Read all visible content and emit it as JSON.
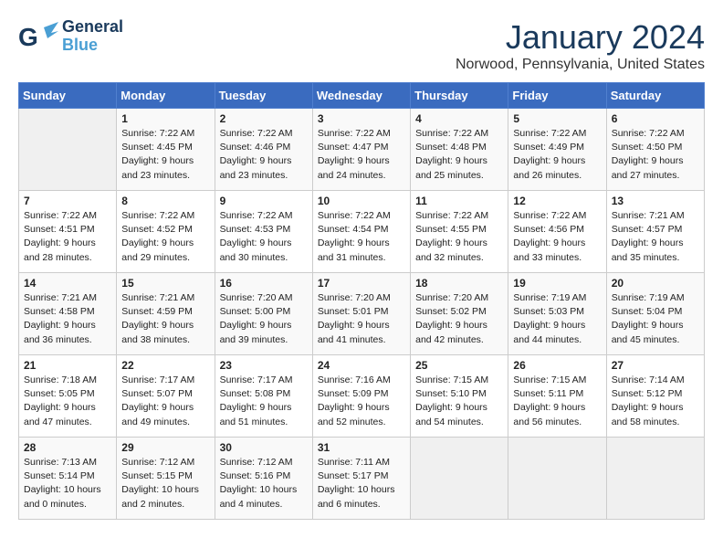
{
  "header": {
    "logo_general": "General",
    "logo_blue": "Blue",
    "month": "January 2024",
    "location": "Norwood, Pennsylvania, United States"
  },
  "weekdays": [
    "Sunday",
    "Monday",
    "Tuesday",
    "Wednesday",
    "Thursday",
    "Friday",
    "Saturday"
  ],
  "weeks": [
    [
      {
        "day": "",
        "info": ""
      },
      {
        "day": "1",
        "info": "Sunrise: 7:22 AM\nSunset: 4:45 PM\nDaylight: 9 hours\nand 23 minutes."
      },
      {
        "day": "2",
        "info": "Sunrise: 7:22 AM\nSunset: 4:46 PM\nDaylight: 9 hours\nand 23 minutes."
      },
      {
        "day": "3",
        "info": "Sunrise: 7:22 AM\nSunset: 4:47 PM\nDaylight: 9 hours\nand 24 minutes."
      },
      {
        "day": "4",
        "info": "Sunrise: 7:22 AM\nSunset: 4:48 PM\nDaylight: 9 hours\nand 25 minutes."
      },
      {
        "day": "5",
        "info": "Sunrise: 7:22 AM\nSunset: 4:49 PM\nDaylight: 9 hours\nand 26 minutes."
      },
      {
        "day": "6",
        "info": "Sunrise: 7:22 AM\nSunset: 4:50 PM\nDaylight: 9 hours\nand 27 minutes."
      }
    ],
    [
      {
        "day": "7",
        "info": "Sunrise: 7:22 AM\nSunset: 4:51 PM\nDaylight: 9 hours\nand 28 minutes."
      },
      {
        "day": "8",
        "info": "Sunrise: 7:22 AM\nSunset: 4:52 PM\nDaylight: 9 hours\nand 29 minutes."
      },
      {
        "day": "9",
        "info": "Sunrise: 7:22 AM\nSunset: 4:53 PM\nDaylight: 9 hours\nand 30 minutes."
      },
      {
        "day": "10",
        "info": "Sunrise: 7:22 AM\nSunset: 4:54 PM\nDaylight: 9 hours\nand 31 minutes."
      },
      {
        "day": "11",
        "info": "Sunrise: 7:22 AM\nSunset: 4:55 PM\nDaylight: 9 hours\nand 32 minutes."
      },
      {
        "day": "12",
        "info": "Sunrise: 7:22 AM\nSunset: 4:56 PM\nDaylight: 9 hours\nand 33 minutes."
      },
      {
        "day": "13",
        "info": "Sunrise: 7:21 AM\nSunset: 4:57 PM\nDaylight: 9 hours\nand 35 minutes."
      }
    ],
    [
      {
        "day": "14",
        "info": "Sunrise: 7:21 AM\nSunset: 4:58 PM\nDaylight: 9 hours\nand 36 minutes."
      },
      {
        "day": "15",
        "info": "Sunrise: 7:21 AM\nSunset: 4:59 PM\nDaylight: 9 hours\nand 38 minutes."
      },
      {
        "day": "16",
        "info": "Sunrise: 7:20 AM\nSunset: 5:00 PM\nDaylight: 9 hours\nand 39 minutes."
      },
      {
        "day": "17",
        "info": "Sunrise: 7:20 AM\nSunset: 5:01 PM\nDaylight: 9 hours\nand 41 minutes."
      },
      {
        "day": "18",
        "info": "Sunrise: 7:20 AM\nSunset: 5:02 PM\nDaylight: 9 hours\nand 42 minutes."
      },
      {
        "day": "19",
        "info": "Sunrise: 7:19 AM\nSunset: 5:03 PM\nDaylight: 9 hours\nand 44 minutes."
      },
      {
        "day": "20",
        "info": "Sunrise: 7:19 AM\nSunset: 5:04 PM\nDaylight: 9 hours\nand 45 minutes."
      }
    ],
    [
      {
        "day": "21",
        "info": "Sunrise: 7:18 AM\nSunset: 5:05 PM\nDaylight: 9 hours\nand 47 minutes."
      },
      {
        "day": "22",
        "info": "Sunrise: 7:17 AM\nSunset: 5:07 PM\nDaylight: 9 hours\nand 49 minutes."
      },
      {
        "day": "23",
        "info": "Sunrise: 7:17 AM\nSunset: 5:08 PM\nDaylight: 9 hours\nand 51 minutes."
      },
      {
        "day": "24",
        "info": "Sunrise: 7:16 AM\nSunset: 5:09 PM\nDaylight: 9 hours\nand 52 minutes."
      },
      {
        "day": "25",
        "info": "Sunrise: 7:15 AM\nSunset: 5:10 PM\nDaylight: 9 hours\nand 54 minutes."
      },
      {
        "day": "26",
        "info": "Sunrise: 7:15 AM\nSunset: 5:11 PM\nDaylight: 9 hours\nand 56 minutes."
      },
      {
        "day": "27",
        "info": "Sunrise: 7:14 AM\nSunset: 5:12 PM\nDaylight: 9 hours\nand 58 minutes."
      }
    ],
    [
      {
        "day": "28",
        "info": "Sunrise: 7:13 AM\nSunset: 5:14 PM\nDaylight: 10 hours\nand 0 minutes."
      },
      {
        "day": "29",
        "info": "Sunrise: 7:12 AM\nSunset: 5:15 PM\nDaylight: 10 hours\nand 2 minutes."
      },
      {
        "day": "30",
        "info": "Sunrise: 7:12 AM\nSunset: 5:16 PM\nDaylight: 10 hours\nand 4 minutes."
      },
      {
        "day": "31",
        "info": "Sunrise: 7:11 AM\nSunset: 5:17 PM\nDaylight: 10 hours\nand 6 minutes."
      },
      {
        "day": "",
        "info": ""
      },
      {
        "day": "",
        "info": ""
      },
      {
        "day": "",
        "info": ""
      }
    ]
  ]
}
